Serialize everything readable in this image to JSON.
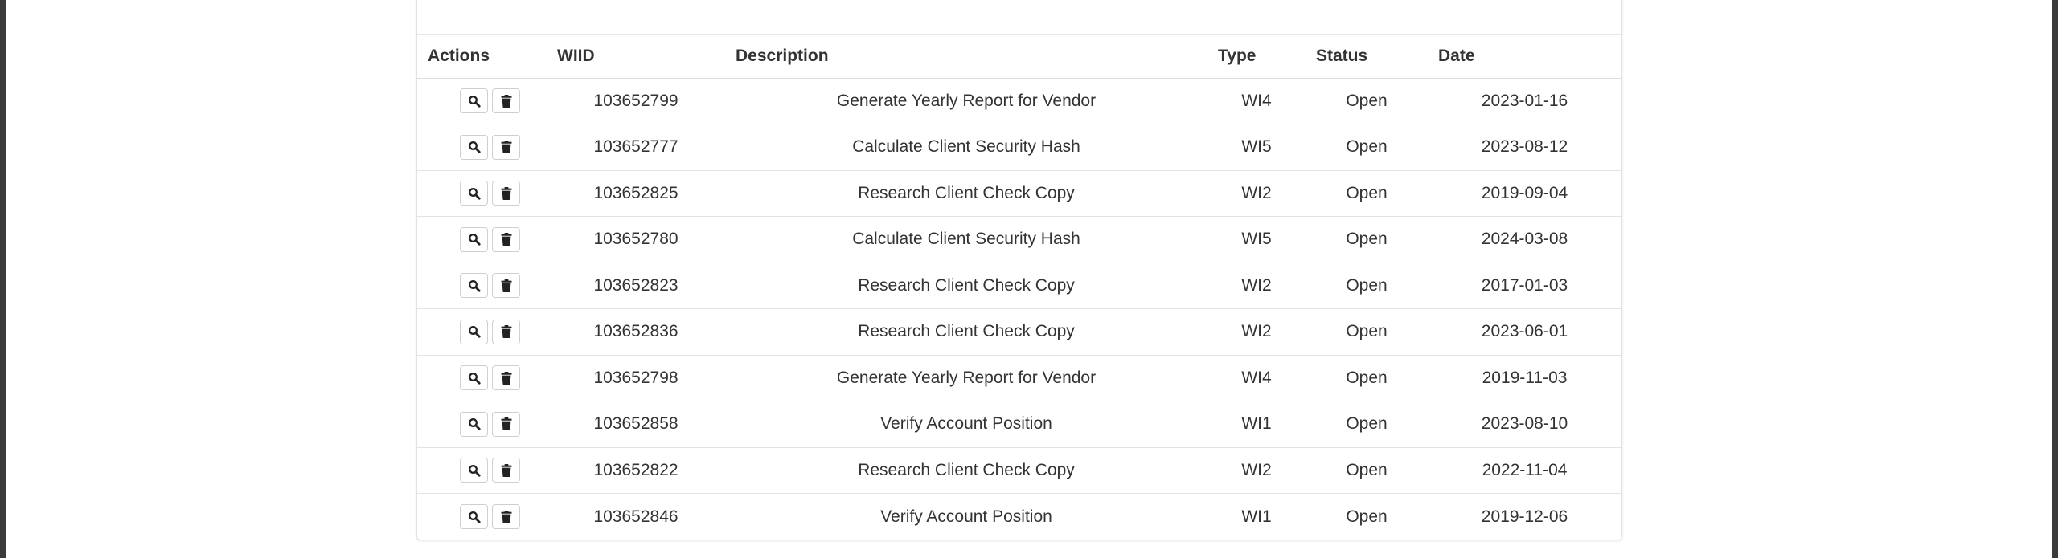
{
  "table": {
    "columns": {
      "actions": "Actions",
      "wiid": "WIID",
      "description": "Description",
      "type": "Type",
      "status": "Status",
      "date": "Date"
    },
    "rows": [
      {
        "wiid": "103652799",
        "description": "Generate Yearly Report for Vendor",
        "type": "WI4",
        "status": "Open",
        "date": "2023-01-16"
      },
      {
        "wiid": "103652777",
        "description": "Calculate Client Security Hash",
        "type": "WI5",
        "status": "Open",
        "date": "2023-08-12"
      },
      {
        "wiid": "103652825",
        "description": "Research Client Check Copy",
        "type": "WI2",
        "status": "Open",
        "date": "2019-09-04"
      },
      {
        "wiid": "103652780",
        "description": "Calculate Client Security Hash",
        "type": "WI5",
        "status": "Open",
        "date": "2024-03-08"
      },
      {
        "wiid": "103652823",
        "description": "Research Client Check Copy",
        "type": "WI2",
        "status": "Open",
        "date": "2017-01-03"
      },
      {
        "wiid": "103652836",
        "description": "Research Client Check Copy",
        "type": "WI2",
        "status": "Open",
        "date": "2023-06-01"
      },
      {
        "wiid": "103652798",
        "description": "Generate Yearly Report for Vendor",
        "type": "WI4",
        "status": "Open",
        "date": "2019-11-03"
      },
      {
        "wiid": "103652858",
        "description": "Verify Account Position",
        "type": "WI1",
        "status": "Open",
        "date": "2023-08-10"
      },
      {
        "wiid": "103652822",
        "description": "Research Client Check Copy",
        "type": "WI2",
        "status": "Open",
        "date": "2022-11-04"
      },
      {
        "wiid": "103652846",
        "description": "Verify Account Position",
        "type": "WI1",
        "status": "Open",
        "date": "2019-12-06"
      }
    ]
  },
  "icons": {
    "view": "search-icon",
    "delete": "trash-icon"
  },
  "colors": {
    "text": "#333333",
    "border": "#dddddd",
    "frame": "#3b3b3b"
  }
}
